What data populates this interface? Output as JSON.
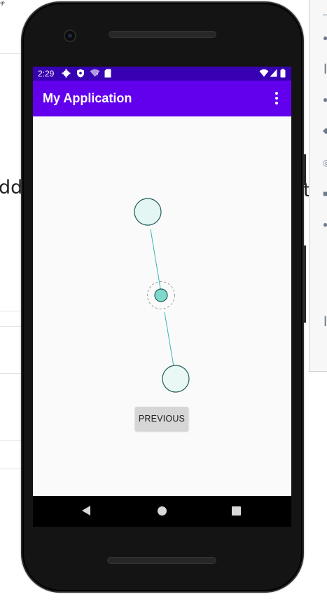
{
  "background": {
    "left_text": "dd",
    "right_text": "t",
    "tab_text": "ዋ"
  },
  "status_bar": {
    "time": "2:29",
    "icons": [
      "settings-icon",
      "shield-icon",
      "wifi-question-icon",
      "sd-card-icon",
      "wifi-icon",
      "signal-icon",
      "battery-icon"
    ]
  },
  "app_bar": {
    "title": "My Application",
    "menu_icon": "overflow-menu-icon"
  },
  "main": {
    "previous_button": "PREVIOUS",
    "fab_icon": "email-icon"
  },
  "nav_bar": {
    "back_icon": "back-icon",
    "home_icon": "home-icon",
    "recents_icon": "recents-icon"
  },
  "colors": {
    "status_bar": "#3700b3",
    "app_bar": "#6200ee",
    "accent": "#03dac5",
    "node_fill": "#e0f7f4",
    "node_center": "#7fd8c9",
    "node_stroke": "#1f5c58"
  }
}
